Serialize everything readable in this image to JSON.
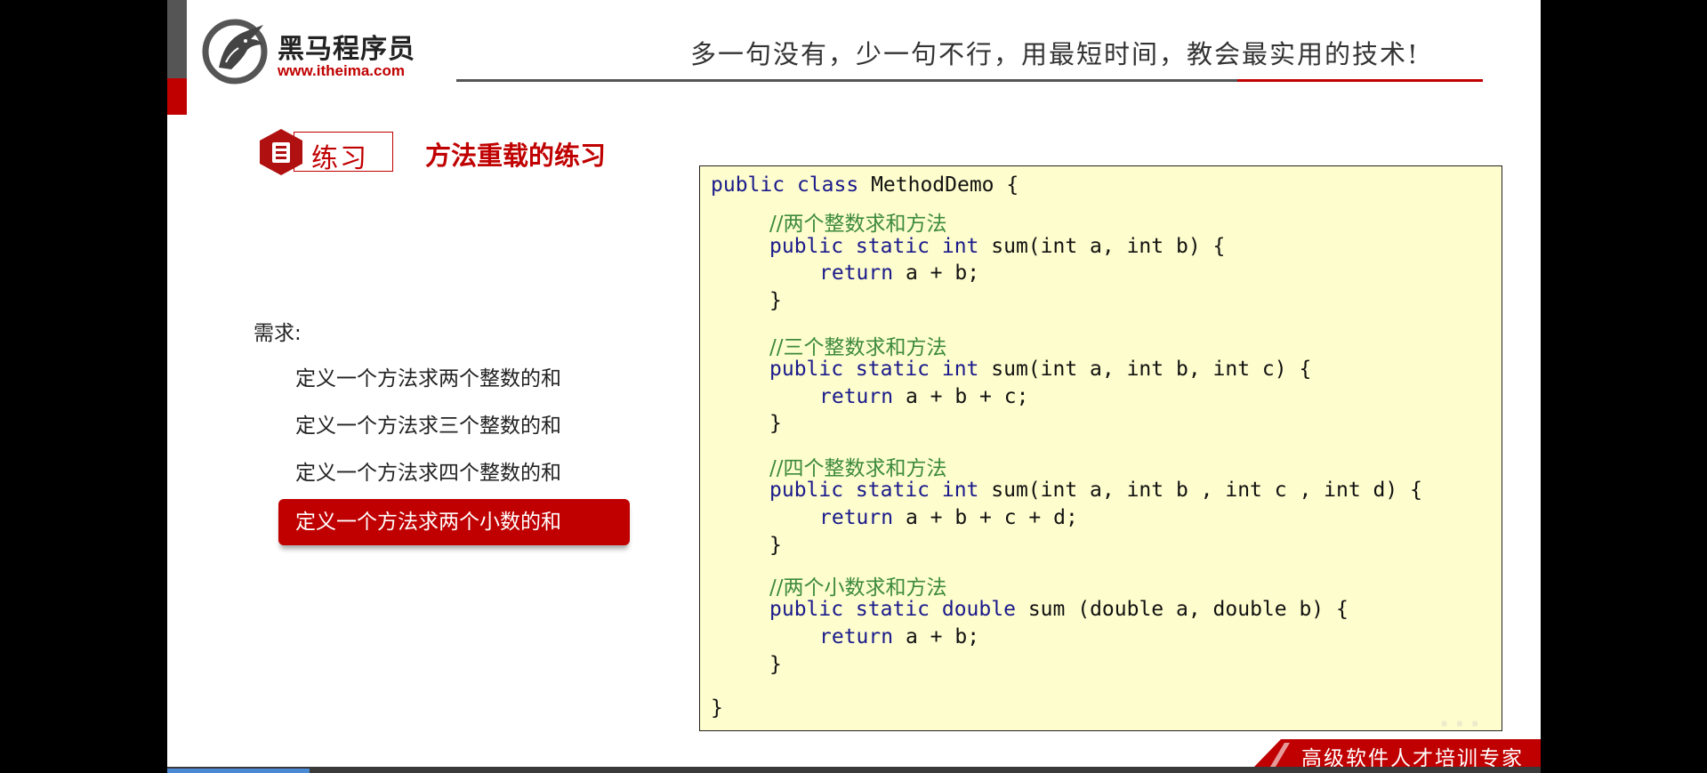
{
  "logo": {
    "title": "黑马程序员",
    "url": "www.itheima.com"
  },
  "header": {
    "slogan": "多一句没有，少一句不行，用最短时间，教会最实用的技术!"
  },
  "section": {
    "badge_label": "练习",
    "title": "方法重载的练习"
  },
  "requirements": {
    "heading": "需求:",
    "items": [
      "定义一个方法求两个整数的和",
      "定义一个方法求三个整数的和",
      "定义一个方法求四个整数的和",
      "定义一个方法求两个小数的和"
    ],
    "highlighted_index": 3
  },
  "code": {
    "class_open": "MethodDemo {",
    "class_close": "}",
    "methods": [
      {
        "comment": "//两个整数求和方法",
        "name": "sum(",
        "params": "int a, int b) {",
        "body": "a + b;",
        "close": "}"
      },
      {
        "comment": "//三个整数求和方法",
        "name": "sum(",
        "params": "int a, int b, int c) {",
        "body": "a + b + c;",
        "close": "}"
      },
      {
        "comment": "//四个整数求和方法",
        "name": "sum(",
        "params": "int a, int b , int c , int d) {",
        "body": "a + b + c + d;",
        "close": "}"
      },
      {
        "comment": "//两个小数求和方法",
        "name": "sum (",
        "params": "double a, double b) {",
        "body": "a + b;",
        "close": "}"
      }
    ]
  },
  "footer": {
    "tagline": "高级软件人才培训专家"
  },
  "colors": {
    "brand_red": "#c00000",
    "code_background": "#fefdcd",
    "keyword": "#1a1a8c",
    "comment": "#3c8a3c"
  },
  "icons": {
    "logo": "horse-logo-icon",
    "badge": "document-icon"
  }
}
